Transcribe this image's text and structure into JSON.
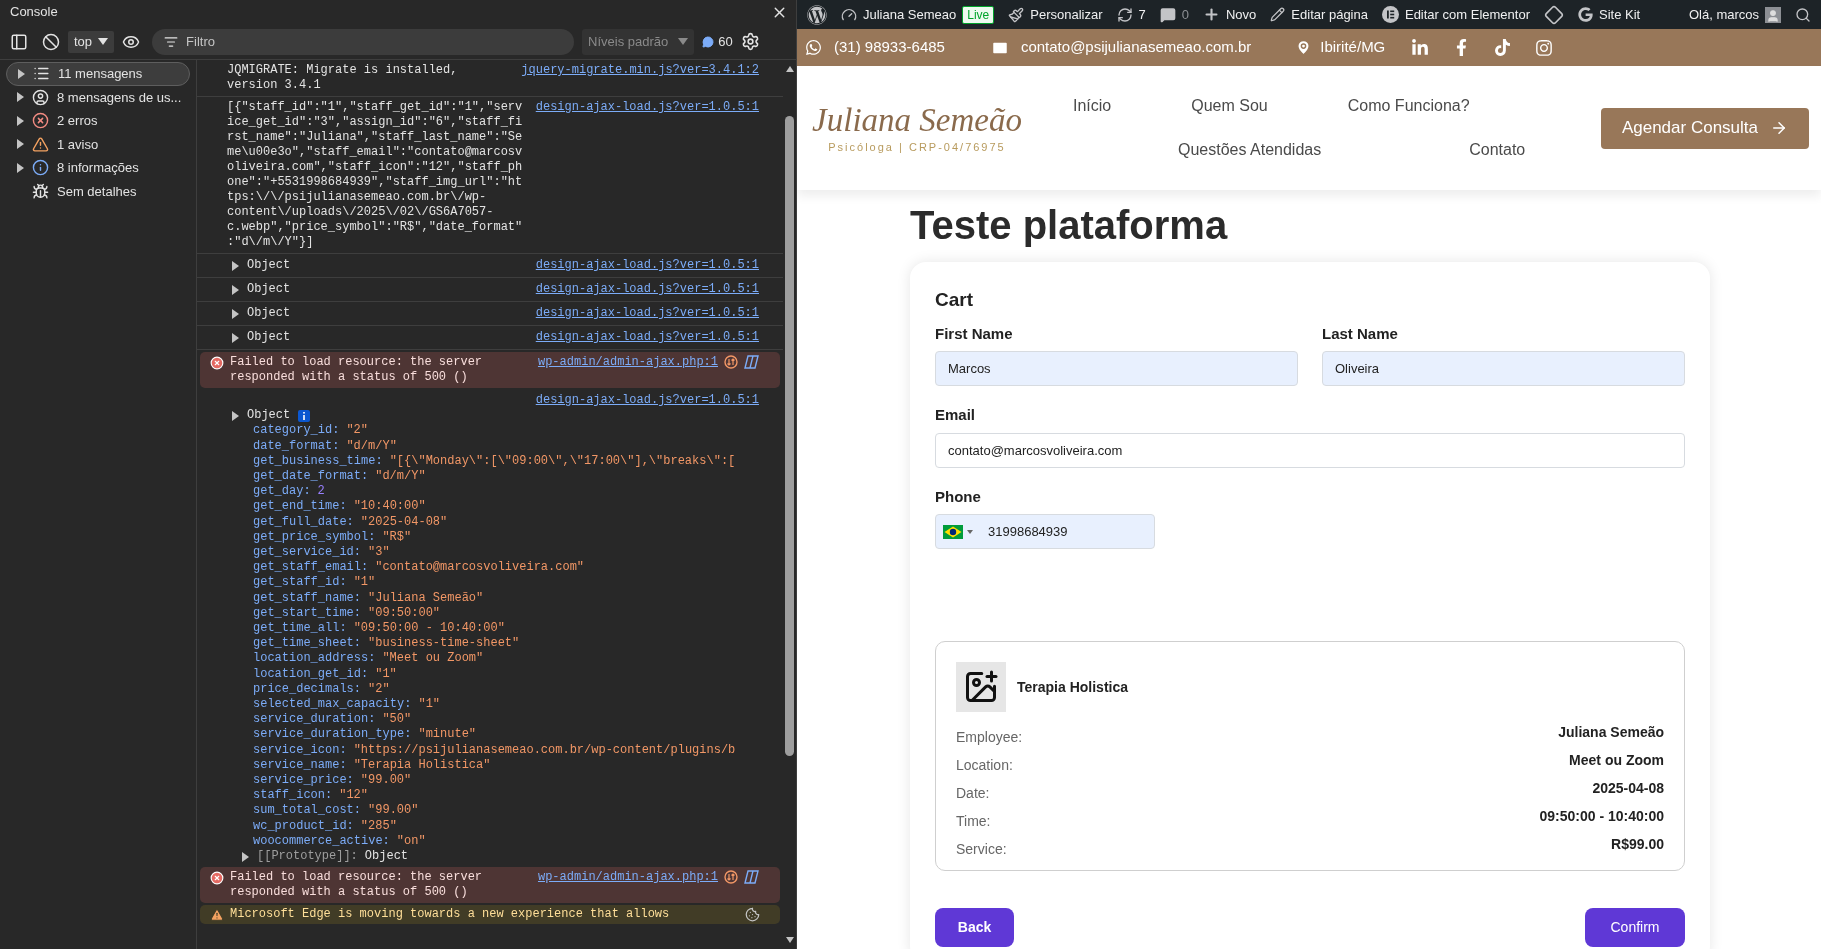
{
  "devtools": {
    "title": "Console",
    "context": "top",
    "filter": {
      "placeholder": "Filtro"
    },
    "levels": "Níveis padrão",
    "issues_count": "60",
    "sidebar": [
      {
        "label": "11 mensagens",
        "kind": "all",
        "expandable": true,
        "selected": true
      },
      {
        "label": "8 mensagens de us...",
        "kind": "user",
        "expandable": true,
        "selected": false
      },
      {
        "label": "2 erros",
        "kind": "error",
        "expandable": true,
        "selected": false
      },
      {
        "label": "1 aviso",
        "kind": "warning",
        "expandable": true,
        "selected": false
      },
      {
        "label": "8 informações",
        "kind": "info",
        "expandable": true,
        "selected": false
      },
      {
        "label": "Sem detalhes",
        "kind": "verbose",
        "expandable": false,
        "selected": false
      }
    ],
    "messages": [
      {
        "kind": "log",
        "text": "JQMIGRATE: Migrate is installed, version 3.4.1",
        "source": "jquery-migrate.min.js?ver=3.4.1:2"
      },
      {
        "kind": "log",
        "text": "[{\"staff_id\":\"1\",\"staff_get_id\":\"1\",\"service_get_id\":\"3\",\"assign_id\":\"6\",\"staff_first_name\":\"Juliana\",\"staff_last_name\":\"Seme\\u00e3o\",\"staff_email\":\"contato@marcosvoliveira.com\",\"staff_icon\":\"12\",\"staff_phone\":\"+5531998684939\",\"staff_img_url\":\"https:\\/\\/psijulianasemeao.com.br\\/wp-content\\/uploads\\/2025\\/02\\/GS6A7057-c.webp\",\"price_symbol\":\"R$\",\"date_format\":\"d\\/m\\/Y\"}]",
        "source": "design-ajax-load.js?ver=1.0.5:1"
      },
      {
        "kind": "object",
        "label": "Object",
        "source": "design-ajax-load.js?ver=1.0.5:1"
      },
      {
        "kind": "object",
        "label": "Object",
        "source": "design-ajax-load.js?ver=1.0.5:1"
      },
      {
        "kind": "object",
        "label": "Object",
        "source": "design-ajax-load.js?ver=1.0.5:1"
      },
      {
        "kind": "object",
        "label": "Object",
        "source": "design-ajax-load.js?ver=1.0.5:1"
      },
      {
        "kind": "error",
        "text": "Failed to load resource: the server responded with a status of 500 ()",
        "source": "wp-admin/admin-ajax.php:1"
      },
      {
        "kind": "object_expanded",
        "label": "Object",
        "source": "design-ajax-load.js?ver=1.0.5:1",
        "properties": [
          {
            "key": "category_id:",
            "value": "\"2\"",
            "kind": "string"
          },
          {
            "key": "date_format:",
            "value": "\"d/m/Y\"",
            "kind": "string"
          },
          {
            "key": "get_business_time:",
            "value": "\"[{\\\"Monday\\\":[\\\"09:00\\\",\\\"17:00\\\"],\\\"breaks\\\":[",
            "kind": "string"
          },
          {
            "key": "get_date_format:",
            "value": "\"d/m/Y\"",
            "kind": "string"
          },
          {
            "key": "get_day:",
            "value": "2",
            "kind": "number"
          },
          {
            "key": "get_end_time:",
            "value": "\"10:40:00\"",
            "kind": "string"
          },
          {
            "key": "get_full_date:",
            "value": "\"2025-04-08\"",
            "kind": "string"
          },
          {
            "key": "get_price_symbol:",
            "value": "\"R$\"",
            "kind": "string"
          },
          {
            "key": "get_service_id:",
            "value": "\"3\"",
            "kind": "string"
          },
          {
            "key": "get_staff_email:",
            "value": "\"contato@marcosvoliveira.com\"",
            "kind": "string"
          },
          {
            "key": "get_staff_id:",
            "value": "\"1\"",
            "kind": "string"
          },
          {
            "key": "get_staff_name:",
            "value": "\"Juliana Semeão\"",
            "kind": "string"
          },
          {
            "key": "get_start_time:",
            "value": "\"09:50:00\"",
            "kind": "string"
          },
          {
            "key": "get_time_all:",
            "value": "\"09:50:00 - 10:40:00\"",
            "kind": "string"
          },
          {
            "key": "get_time_sheet:",
            "value": "\"business-time-sheet\"",
            "kind": "string"
          },
          {
            "key": "location_address:",
            "value": "\"Meet ou Zoom\"",
            "kind": "string"
          },
          {
            "key": "location_get_id:",
            "value": "\"1\"",
            "kind": "string"
          },
          {
            "key": "price_decimals:",
            "value": "\"2\"",
            "kind": "string"
          },
          {
            "key": "selected_max_capacity:",
            "value": "\"1\"",
            "kind": "string"
          },
          {
            "key": "service_duration:",
            "value": "\"50\"",
            "kind": "string"
          },
          {
            "key": "service_duration_type:",
            "value": "\"minute\"",
            "kind": "string"
          },
          {
            "key": "service_icon:",
            "value": "\"https://psijulianasemeao.com.br/wp-content/plugins/b",
            "kind": "string"
          },
          {
            "key": "service_name:",
            "value": "\"Terapia Holistica\"",
            "kind": "string"
          },
          {
            "key": "service_price:",
            "value": "\"99.00\"",
            "kind": "string"
          },
          {
            "key": "staff_icon:",
            "value": "\"12\"",
            "kind": "string"
          },
          {
            "key": "sum_total_cost:",
            "value": "\"99.00\"",
            "kind": "string"
          },
          {
            "key": "wc_product_id:",
            "value": "\"285\"",
            "kind": "string"
          },
          {
            "key": "woocommerce_active:",
            "value": "\"on\"",
            "kind": "string"
          }
        ],
        "prototype": {
          "key": "[[Prototype]]:",
          "value": "Object"
        }
      },
      {
        "kind": "error",
        "text": "Failed to load resource: the server responded with a status of 500 ()",
        "source": "wp-admin/admin-ajax.php:1"
      },
      {
        "kind": "warning",
        "text": "Microsoft Edge is moving towards a new experience that allows"
      }
    ]
  },
  "admin_bar": {
    "items": [
      {
        "kind": "wordpress"
      },
      {
        "kind": "dashboard",
        "label": "Juliana Semeao"
      },
      {
        "kind": "badge",
        "label": "Live"
      },
      {
        "kind": "brush",
        "label": "Personalizar"
      },
      {
        "kind": "updates",
        "label": "7"
      },
      {
        "kind": "comments",
        "label": "0"
      },
      {
        "kind": "new",
        "label": "Novo"
      },
      {
        "kind": "edit",
        "label": "Editar página"
      },
      {
        "kind": "elementor",
        "label": "Editar com Elementor"
      },
      {
        "kind": "diamond"
      },
      {
        "kind": "google",
        "label": "Site Kit"
      }
    ],
    "greeting": "Olá, marcos"
  },
  "top_bar": {
    "phone": "(31) 98933-6485",
    "email": "contato@psijulianasemeao.com.br",
    "location": "Ibirité/MG",
    "social": [
      {
        "kind": "linkedin"
      },
      {
        "kind": "facebook"
      },
      {
        "kind": "tiktok"
      },
      {
        "kind": "instagram"
      }
    ]
  },
  "header": {
    "logo": {
      "name": "Juliana Semeão",
      "subtitle": "Psicóloga | CRP-04/76975"
    },
    "nav_rows": [
      [
        "Início",
        "Quem Sou",
        "Como Funciona?"
      ],
      [
        "Questões Atendidas",
        "Contato"
      ]
    ],
    "cta": "Agendar Consulta"
  },
  "page": {
    "title": "Teste plataforma",
    "form": {
      "heading": "Cart",
      "first_name": {
        "label": "First Name",
        "value": "Marcos"
      },
      "last_name": {
        "label": "Last Name",
        "value": "Oliveira"
      },
      "email": {
        "label": "Email",
        "value": "contato@marcosvoliveira.com"
      },
      "phone": {
        "label": "Phone",
        "value": "31998684939"
      }
    },
    "summary": {
      "service": "Terapia Holistica",
      "rows": [
        {
          "label": "Employee:",
          "value": "Juliana Semeão"
        },
        {
          "label": "Location:",
          "value": "Meet ou Zoom"
        },
        {
          "label": "Date:",
          "value": "2025-04-08"
        },
        {
          "label": "Time:",
          "value": "09:50:00 - 10:40:00"
        },
        {
          "label": "Service:",
          "value": "R$99.00"
        }
      ]
    },
    "buttons": {
      "back": "Back",
      "confirm": "Confirm"
    }
  }
}
